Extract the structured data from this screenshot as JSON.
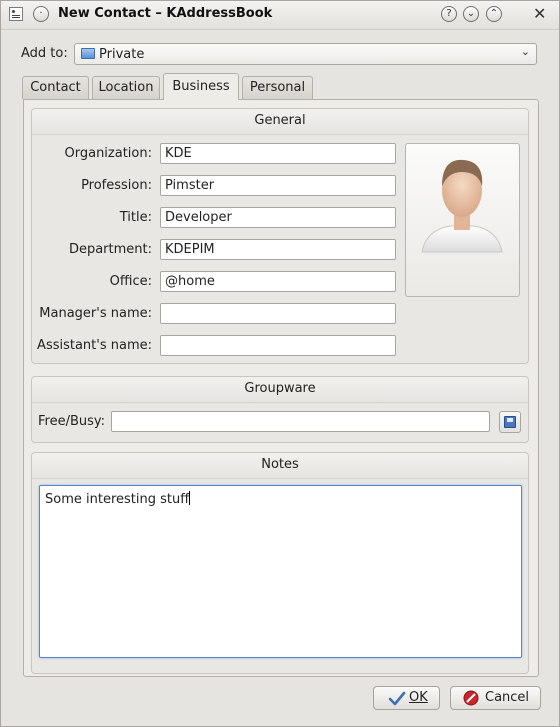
{
  "window": {
    "title": "New Contact – KAddressBook"
  },
  "titlebar": {
    "help": "?",
    "minimize": "⌄",
    "maximize": "⌃",
    "close": "✕"
  },
  "addto": {
    "label": "Add to:",
    "value": "Private"
  },
  "tabs": [
    {
      "label": "Contact",
      "active": false
    },
    {
      "label": "Location",
      "active": false
    },
    {
      "label": "Business",
      "active": true
    },
    {
      "label": "Personal",
      "active": false
    }
  ],
  "general": {
    "title": "General",
    "fields": [
      {
        "label": "Organization:",
        "value": "KDE"
      },
      {
        "label": "Profession:",
        "value": "Pimster"
      },
      {
        "label": "Title:",
        "value": "Developer"
      },
      {
        "label": "Department:",
        "value": "KDEPIM"
      },
      {
        "label": "Office:",
        "value": "@home"
      },
      {
        "label": "Manager's name:",
        "value": ""
      },
      {
        "label": "Assistant's name:",
        "value": ""
      }
    ]
  },
  "groupware": {
    "title": "Groupware",
    "freebusy_label": "Free/Busy:",
    "freebusy_value": ""
  },
  "notes": {
    "title": "Notes",
    "text": "Some interesting stuff"
  },
  "buttons": {
    "ok": "OK",
    "cancel": "Cancel"
  },
  "colors": {
    "accent": "#5a86c4",
    "cancel_icon": "#c8262b",
    "ok_icon": "#3d6fb8"
  }
}
